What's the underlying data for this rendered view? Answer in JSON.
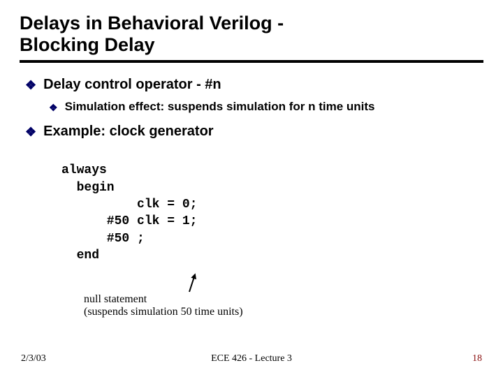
{
  "title_line1": "Delays in Behavioral Verilog -",
  "title_line2": "Blocking Delay",
  "bullets": {
    "b1": "Delay control operator - #n",
    "b1_sub": "Simulation effect: suspends simulation for n time units",
    "b2": "Example: clock generator"
  },
  "code": {
    "l1": "always",
    "l2": "  begin",
    "l3": "          clk = 0;",
    "l4": "      #50 clk = 1;",
    "l5": "      #50 ;",
    "l6": "  end"
  },
  "annotation": {
    "l1": "null statement",
    "l2": "(suspends simulation 50 time units)"
  },
  "footer": {
    "date": "2/3/03",
    "center": "ECE 426 - Lecture 3",
    "page": "18"
  }
}
